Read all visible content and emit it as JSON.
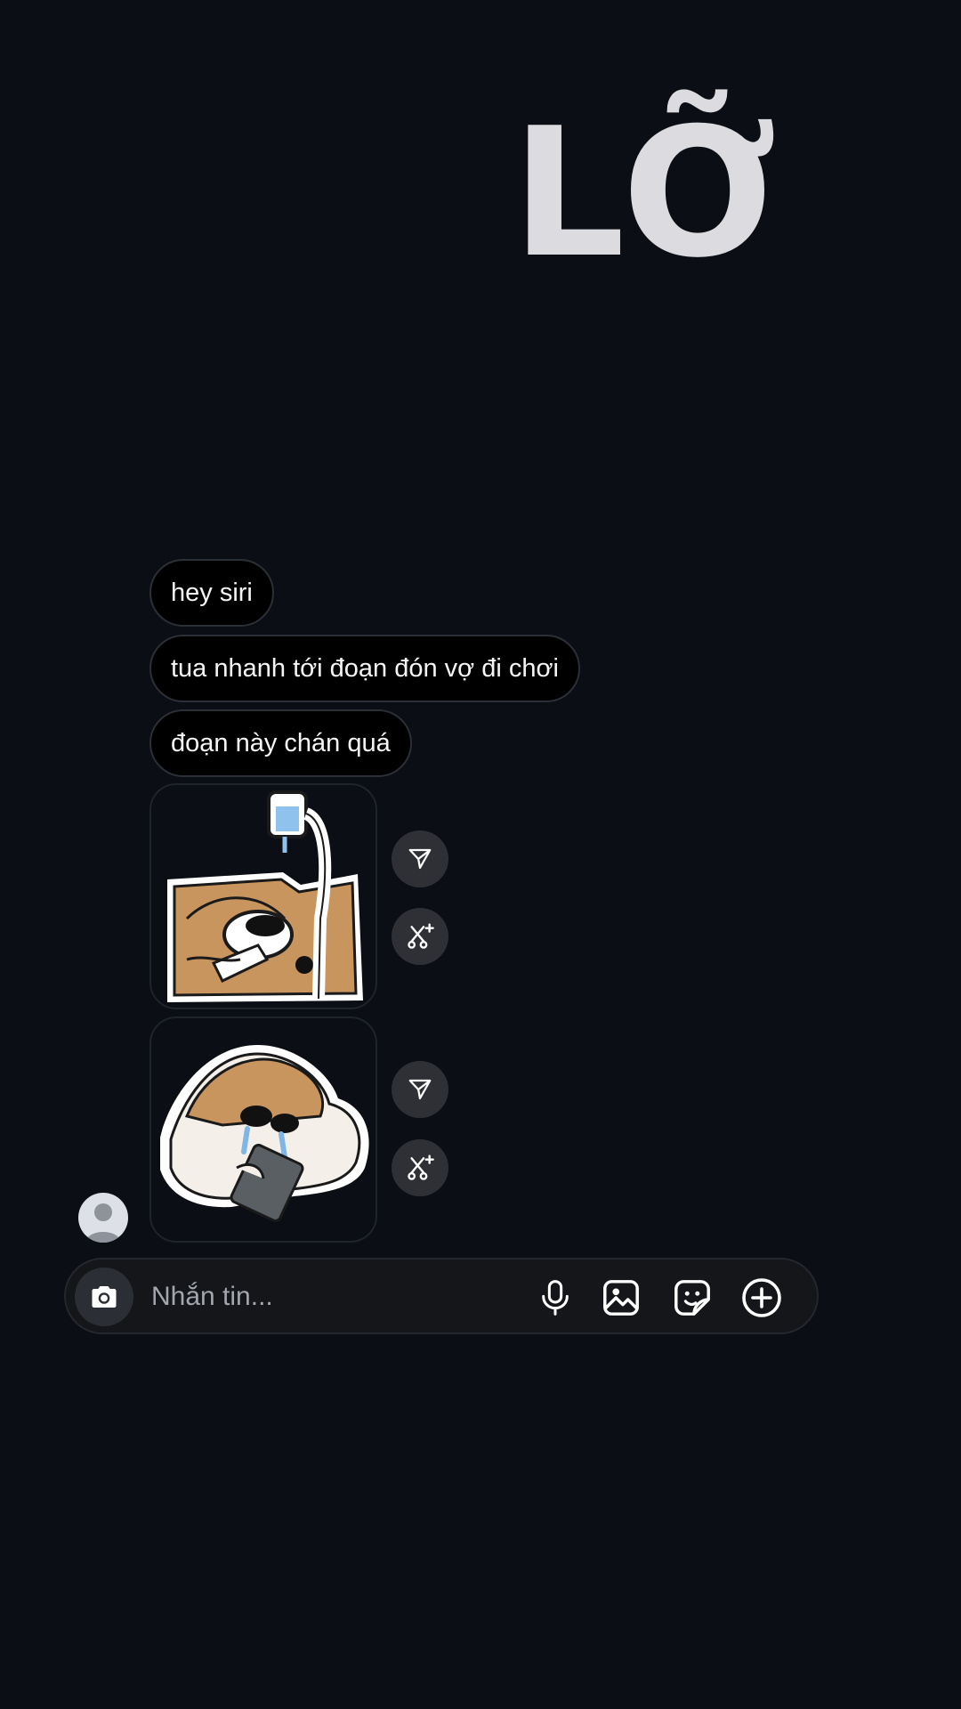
{
  "overlay": {
    "text": "LỠ"
  },
  "messages": [
    {
      "text": "hey siri"
    },
    {
      "text": "tua nhanh tới đoạn đón vợ đi chơi"
    },
    {
      "text": "đoạn này chán quá"
    }
  ],
  "stickers": [
    {
      "icon": "crying-puppy-iv-drip-sticker"
    },
    {
      "icon": "crying-puppy-phone-sticker"
    }
  ],
  "sticker_actions": {
    "share_icon": "send-icon",
    "remix_icon": "ai-remix-icon"
  },
  "sender": {
    "avatar_icon": "person-icon"
  },
  "composer": {
    "placeholder": "Nhắn tin...",
    "camera_icon": "camera-icon",
    "tools": [
      "microphone-icon",
      "gallery-icon",
      "sticker-icon",
      "add-icon"
    ]
  },
  "colors": {
    "background": "#0b0e14",
    "bubble": "#000000",
    "action_button": "#2e3036",
    "composer": "#141619"
  }
}
